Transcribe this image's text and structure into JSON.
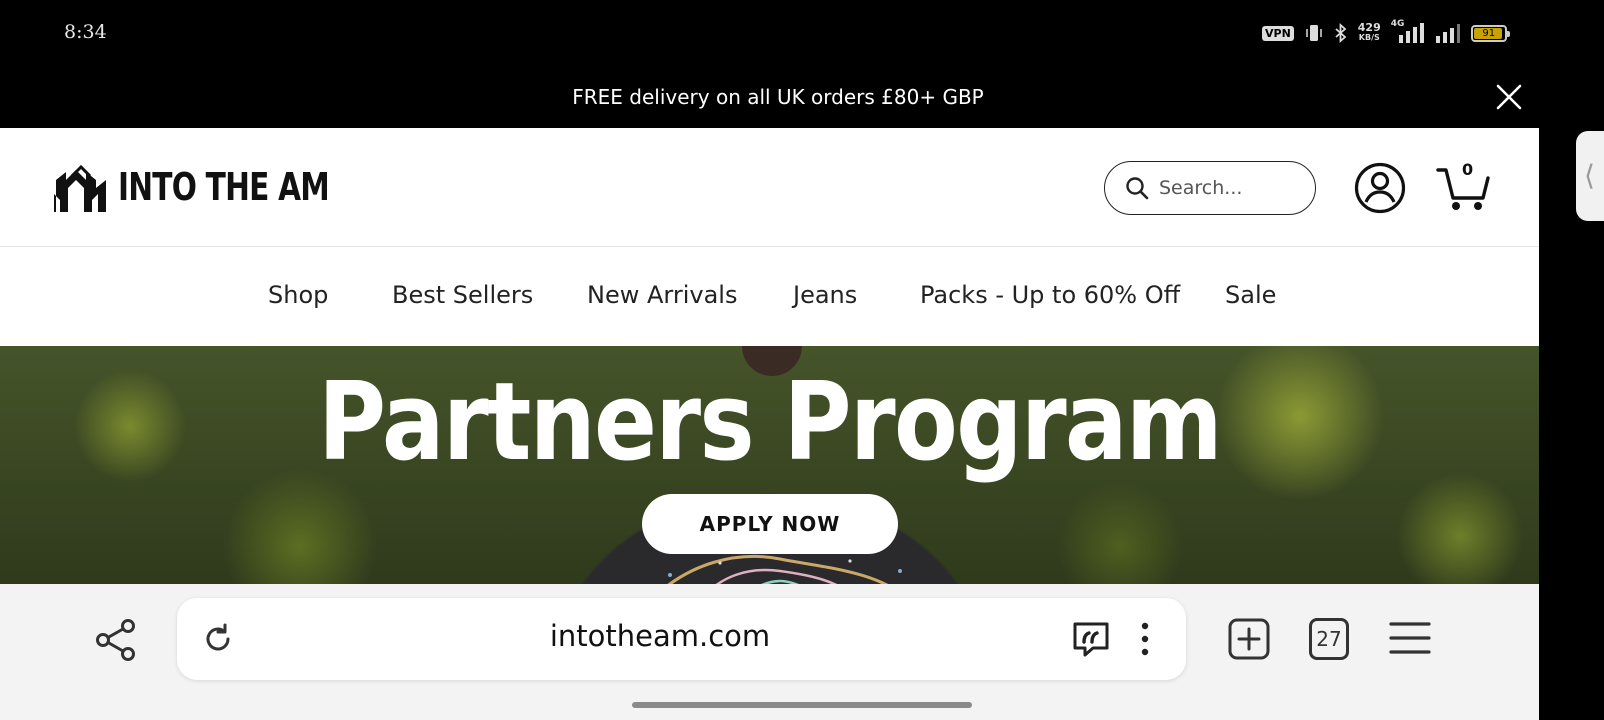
{
  "status_bar": {
    "time": "8:34",
    "vpn": "VPN",
    "net_speed": "429",
    "net_unit": "KB/S",
    "network_type": "4G",
    "battery": "91",
    "icons": [
      "vibrate-icon",
      "bluetooth-icon",
      "signal-4g-icon",
      "signal-icon",
      "battery-icon"
    ]
  },
  "promo": {
    "text": "FREE delivery on all UK orders £80+ GBP",
    "close_icon": "close-icon"
  },
  "header": {
    "logo_text": "INTO THE AM",
    "search_placeholder": "Search...",
    "cart_count": "0"
  },
  "nav": {
    "items": [
      {
        "label": "Shop"
      },
      {
        "label": "Best Sellers"
      },
      {
        "label": "New Arrivals"
      },
      {
        "label": "Jeans"
      },
      {
        "label": "Packs - Up to 60% Off"
      },
      {
        "label": "Sale"
      }
    ]
  },
  "hero": {
    "title": "Partners Program",
    "cta": "APPLY NOW"
  },
  "browser": {
    "url": "intotheam.com",
    "tab_count": "27"
  },
  "colors": {
    "promo_bg": "#000000",
    "header_bg": "#ffffff",
    "browser_bar_bg": "#f3f3f3",
    "battery_fill": "#c8a200"
  }
}
